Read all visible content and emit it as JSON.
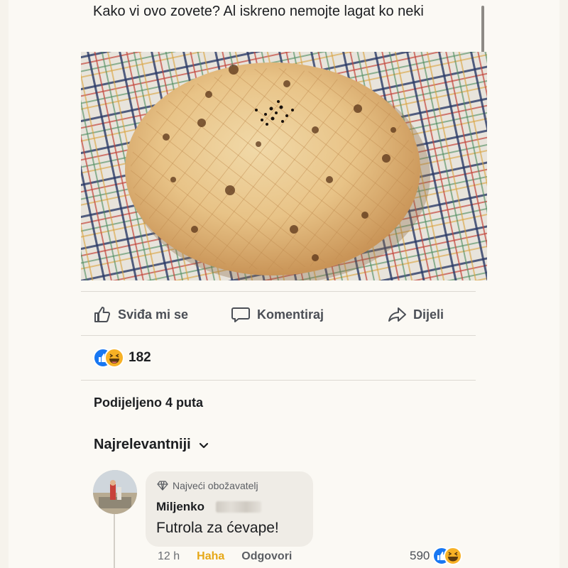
{
  "post": {
    "text": "Kako vi ovo zovete? Al iskreno nemojte lagat ko neki"
  },
  "actions": {
    "like_label": "Sviđa mi se",
    "comment_label": "Komentiraj",
    "share_label": "Dijeli"
  },
  "reactions": {
    "count": "182",
    "icons": [
      "like-icon",
      "haha-icon"
    ]
  },
  "shares": {
    "text": "Podijeljeno 4 puta"
  },
  "comments_sort": {
    "label": "Najrelevantniji"
  },
  "comment": {
    "badge": "Najveći obožavatelj",
    "author": "Miljenko",
    "text": "Futrola za ćevape!",
    "time": "12 h",
    "reaction_label": "Haha",
    "reply_label": "Odgovori",
    "reaction_count": "590"
  },
  "colors": {
    "like_blue": "#1877f2",
    "haha_yellow": "#f7b125",
    "haha_text": "#e6a817"
  }
}
